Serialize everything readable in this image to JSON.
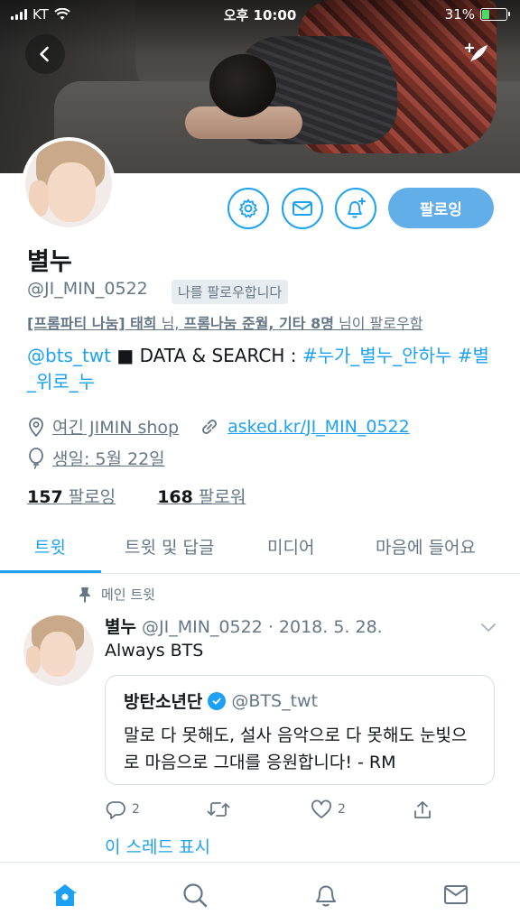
{
  "status_bar": {
    "carrier": "KT",
    "time": "오후 10:00",
    "battery_percent": "31%",
    "battery_level": 0.31
  },
  "profile": {
    "name": "별누",
    "handle": "@JI_MIN_0522",
    "follows_you": "나를 팔로우합니다",
    "followed_by_prefix": "[프롬파티 나눔] 태희",
    "followed_by_mid": " 님, ",
    "followed_by_names": "프롬나눔 준월, 기타 8명",
    "followed_by_suffix": " 님이 팔로우함",
    "bio_mention": "@bts_twt",
    "bio_text": " ■ DATA & SEARCH : ",
    "bio_hashtag1": "#누가_별누_안하누",
    "bio_hashtag2": " #별_위로_누",
    "location": "여긴 JIMIN shop",
    "website": "asked.kr/JI_MIN_0522",
    "birthday": "생일: 5월 22일",
    "following_count": "157",
    "following_label": " 팔로잉",
    "followers_count": "168",
    "followers_label": " 팔로워",
    "follow_button": "팔로잉"
  },
  "tabs": [
    "트윗",
    "트윗 및 답글",
    "미디어",
    "마음에 들어요"
  ],
  "tweet": {
    "pinned_label": "메인 트윗",
    "author": "별누",
    "meta": " @JI_MIN_0522 · 2018. 5. 28.",
    "text": "Always BTS",
    "quote": {
      "author": "방탄소년단",
      "handle": "@BTS_twt",
      "text": "말로 다 못해도, 설사 음악으로 다 못해도 눈빛으로 마음으로 그대를 응원합니다! - RM"
    },
    "reply_count": "2",
    "like_count": "2",
    "thread_link": "이 스레드 표시"
  },
  "colors": {
    "accent": "#1da1f2",
    "follow_button": "#62aee8",
    "muted": "#657786"
  },
  "icons": [
    "back-arrow-icon",
    "compose-icon",
    "gear-icon",
    "mail-icon",
    "bell-plus-icon",
    "location-pin-icon",
    "link-icon",
    "balloon-icon",
    "pin-icon",
    "chevron-down-icon",
    "reply-icon",
    "retweet-icon",
    "heart-icon",
    "share-icon",
    "home-icon",
    "search-icon",
    "bell-icon",
    "messages-icon"
  ]
}
